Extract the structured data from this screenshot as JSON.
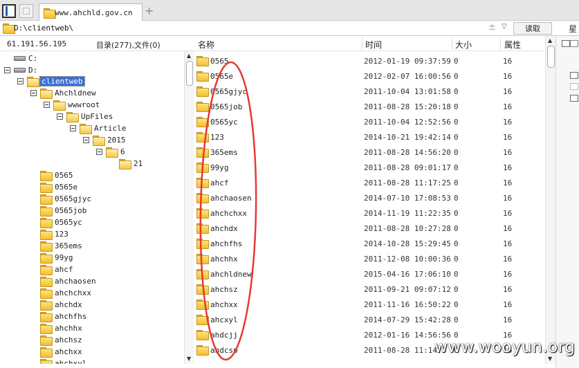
{
  "tab": {
    "title": "www.ahchld.gov.cn"
  },
  "address": {
    "path": "D:\\clientweb\\",
    "read_button": "读取",
    "right_tab_label": "星"
  },
  "left_header": {
    "ip": "61.191.56.195",
    "summary": "目录(277),文件(0)"
  },
  "tree": {
    "drives": [
      {
        "label": "C:"
      },
      {
        "label": "D:"
      }
    ],
    "path_nodes": [
      {
        "label": "clientweb"
      },
      {
        "label": "Ahchldnew"
      },
      {
        "label": "wwwroot"
      },
      {
        "label": "UpFiles"
      },
      {
        "label": "Article"
      },
      {
        "label": "2015"
      },
      {
        "label": "6"
      },
      {
        "label": "21"
      }
    ],
    "children": [
      "0565",
      "0565e",
      "0565gjyc",
      "0565job",
      "0565yc",
      "123",
      "365ems",
      "99yg",
      "ahcf",
      "ahchaosen",
      "ahchchxx",
      "ahchdx",
      "ahchfhs",
      "ahchhx",
      "ahchsz",
      "ahchxx",
      "ahchxyl"
    ]
  },
  "list": {
    "columns": {
      "name": "名称",
      "time": "时间",
      "size": "大小",
      "attr": "属性"
    },
    "rows": [
      {
        "name": "0565",
        "time": "2012-01-19 09:37:59",
        "size": "0",
        "attr": "16"
      },
      {
        "name": "0565e",
        "time": "2012-02-07 16:00:56",
        "size": "0",
        "attr": "16"
      },
      {
        "name": "0565gjyc",
        "time": "2011-10-04 13:01:58",
        "size": "0",
        "attr": "16"
      },
      {
        "name": "0565job",
        "time": "2011-08-28 15:20:18",
        "size": "0",
        "attr": "16"
      },
      {
        "name": "0565yc",
        "time": "2011-10-04 12:52:56",
        "size": "0",
        "attr": "16"
      },
      {
        "name": "123",
        "time": "2014-10-21 19:42:14",
        "size": "0",
        "attr": "16"
      },
      {
        "name": "365ems",
        "time": "2011-08-28 14:56:20",
        "size": "0",
        "attr": "16"
      },
      {
        "name": "99yg",
        "time": "2011-08-28 09:01:17",
        "size": "0",
        "attr": "16"
      },
      {
        "name": "ahcf",
        "time": "2011-08-28 11:17:25",
        "size": "0",
        "attr": "16"
      },
      {
        "name": "ahchaosen",
        "time": "2014-07-10 17:08:53",
        "size": "0",
        "attr": "16"
      },
      {
        "name": "ahchchxx",
        "time": "2014-11-19 11:22:35",
        "size": "0",
        "attr": "16"
      },
      {
        "name": "ahchdx",
        "time": "2011-08-28 10:27:28",
        "size": "0",
        "attr": "16"
      },
      {
        "name": "ahchfhs",
        "time": "2014-10-28 15:29:45",
        "size": "0",
        "attr": "16"
      },
      {
        "name": "ahchhx",
        "time": "2011-12-08 10:00:36",
        "size": "0",
        "attr": "16"
      },
      {
        "name": "ahchldnew",
        "time": "2015-04-16 17:06:10",
        "size": "0",
        "attr": "16"
      },
      {
        "name": "ahchsz",
        "time": "2011-09-21 09:07:12",
        "size": "0",
        "attr": "16"
      },
      {
        "name": "ahchxx",
        "time": "2011-11-16 16:50:22",
        "size": "0",
        "attr": "16"
      },
      {
        "name": "ahcxyl",
        "time": "2014-07-29 15:42:28",
        "size": "0",
        "attr": "16"
      },
      {
        "name": "ahdcjj",
        "time": "2012-01-16 14:56:56",
        "size": "0",
        "attr": "16"
      },
      {
        "name": "ahdcsp",
        "time": "2011-08-28 11:14:5",
        "size": "0",
        "attr": "16"
      }
    ]
  },
  "colors": {
    "selection": "#3b6fd6",
    "annotation": "#e53935",
    "folder": "#f3bf2e"
  },
  "watermark": "www.wooyun.org"
}
